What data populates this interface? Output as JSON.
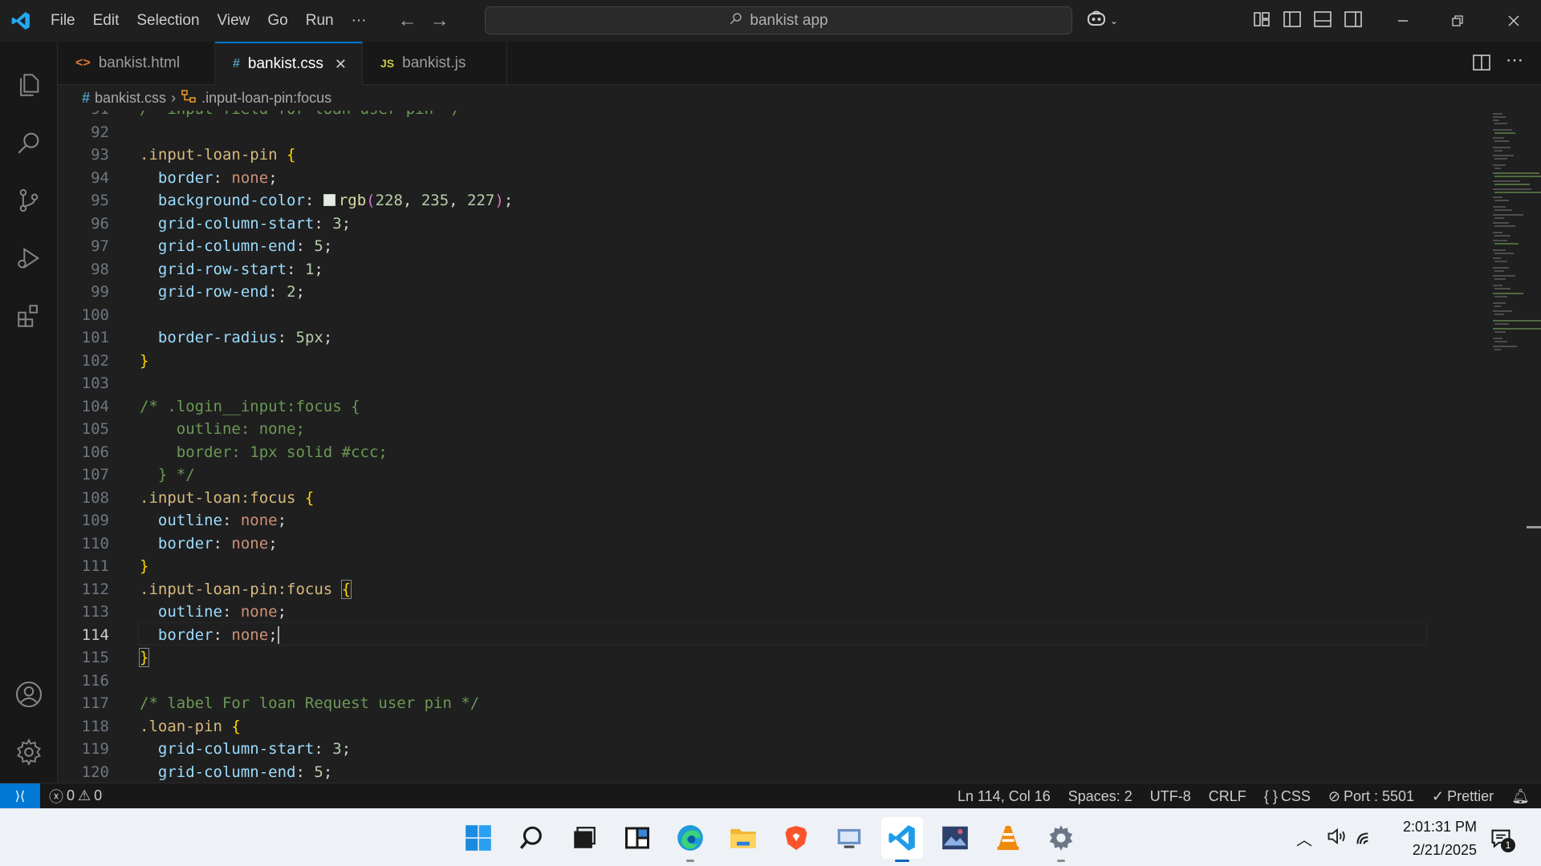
{
  "menu": {
    "items": [
      "File",
      "Edit",
      "Selection",
      "View",
      "Go",
      "Run",
      "···"
    ]
  },
  "search": {
    "label": "bankist app"
  },
  "tabs": [
    {
      "icon": "<>",
      "label": "bankist.html",
      "icon_color": "#e37933"
    },
    {
      "icon": "#",
      "label": "bankist.css",
      "icon_color": "#519aba",
      "close": "✕"
    },
    {
      "icon": "JS",
      "label": "bankist.js",
      "icon_color": "#cbcb41"
    }
  ],
  "breadcrumb": {
    "file_icon": "#",
    "file": "bankist.css",
    "separator": "›",
    "symbol": ".input-loan-pin:focus"
  },
  "editor": {
    "top_partial_comment": "/* input field for loan user pin */",
    "current_line": 114
  },
  "status": {
    "errors": "0",
    "warnings": "0",
    "position": "Ln 114, Col 16",
    "spaces": "Spaces: 2",
    "encoding": "UTF-8",
    "eol": "CRLF",
    "language": "CSS",
    "port": "Port : 5501",
    "prettier": "Prettier"
  },
  "clock": {
    "time": "2:01:31 PM",
    "date": "2/21/2025"
  },
  "notifications": {
    "count": "1"
  },
  "colors": {
    "accent": "#0078d4",
    "swatch": "#e4ebe3"
  }
}
